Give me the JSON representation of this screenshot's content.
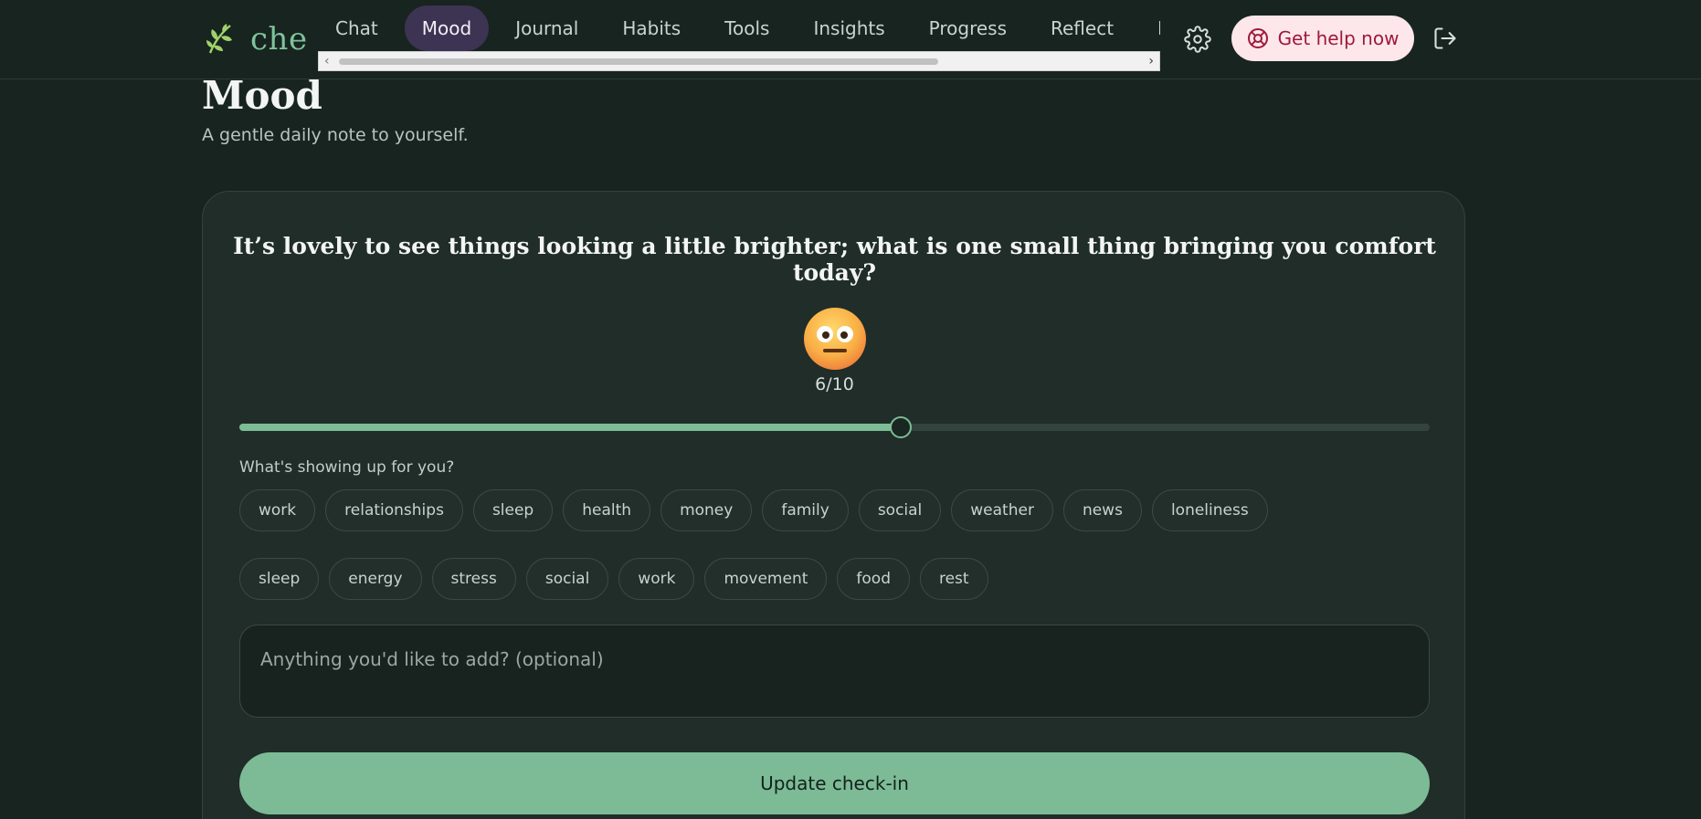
{
  "brand": {
    "name": "che",
    "logo_icon": "leaf-icon"
  },
  "nav": {
    "items": [
      {
        "label": "Chat"
      },
      {
        "label": "Mood",
        "active": true
      },
      {
        "label": "Journal"
      },
      {
        "label": "Habits"
      },
      {
        "label": "Tools"
      },
      {
        "label": "Insights"
      },
      {
        "label": "Progress"
      },
      {
        "label": "Reflect"
      },
      {
        "label": "Patterns"
      }
    ]
  },
  "header": {
    "settings_icon": "gear-icon",
    "help_label": "Get help now",
    "help_icon": "lifebuoy-icon",
    "logout_icon": "logout-icon",
    "help_color": "#a0193a"
  },
  "page": {
    "title": "Mood",
    "subtitle": "A gentle daily note to yourself."
  },
  "checkin": {
    "prompt": "It’s lovely to see things looking a little brighter; what is one small thing bringing you comfort today?",
    "emoji_icon": "neutral-face-icon",
    "score_text": "6/10",
    "score_value": 6,
    "score_max": 10,
    "tags_label": "What's showing up for you?",
    "tags_row1": [
      "work",
      "relationships",
      "sleep",
      "health",
      "money",
      "family",
      "social",
      "weather",
      "news",
      "loneliness"
    ],
    "tags_row2": [
      "sleep",
      "energy",
      "stress",
      "social",
      "work",
      "movement",
      "food",
      "rest"
    ],
    "note_placeholder": "Anything you'd like to add? (optional)",
    "note_value": "",
    "submit_label": "Update check-in"
  },
  "colors": {
    "accent": "#7cbb96",
    "active_nav": "#3c3452",
    "background": "#182420",
    "card": "#202d29"
  }
}
